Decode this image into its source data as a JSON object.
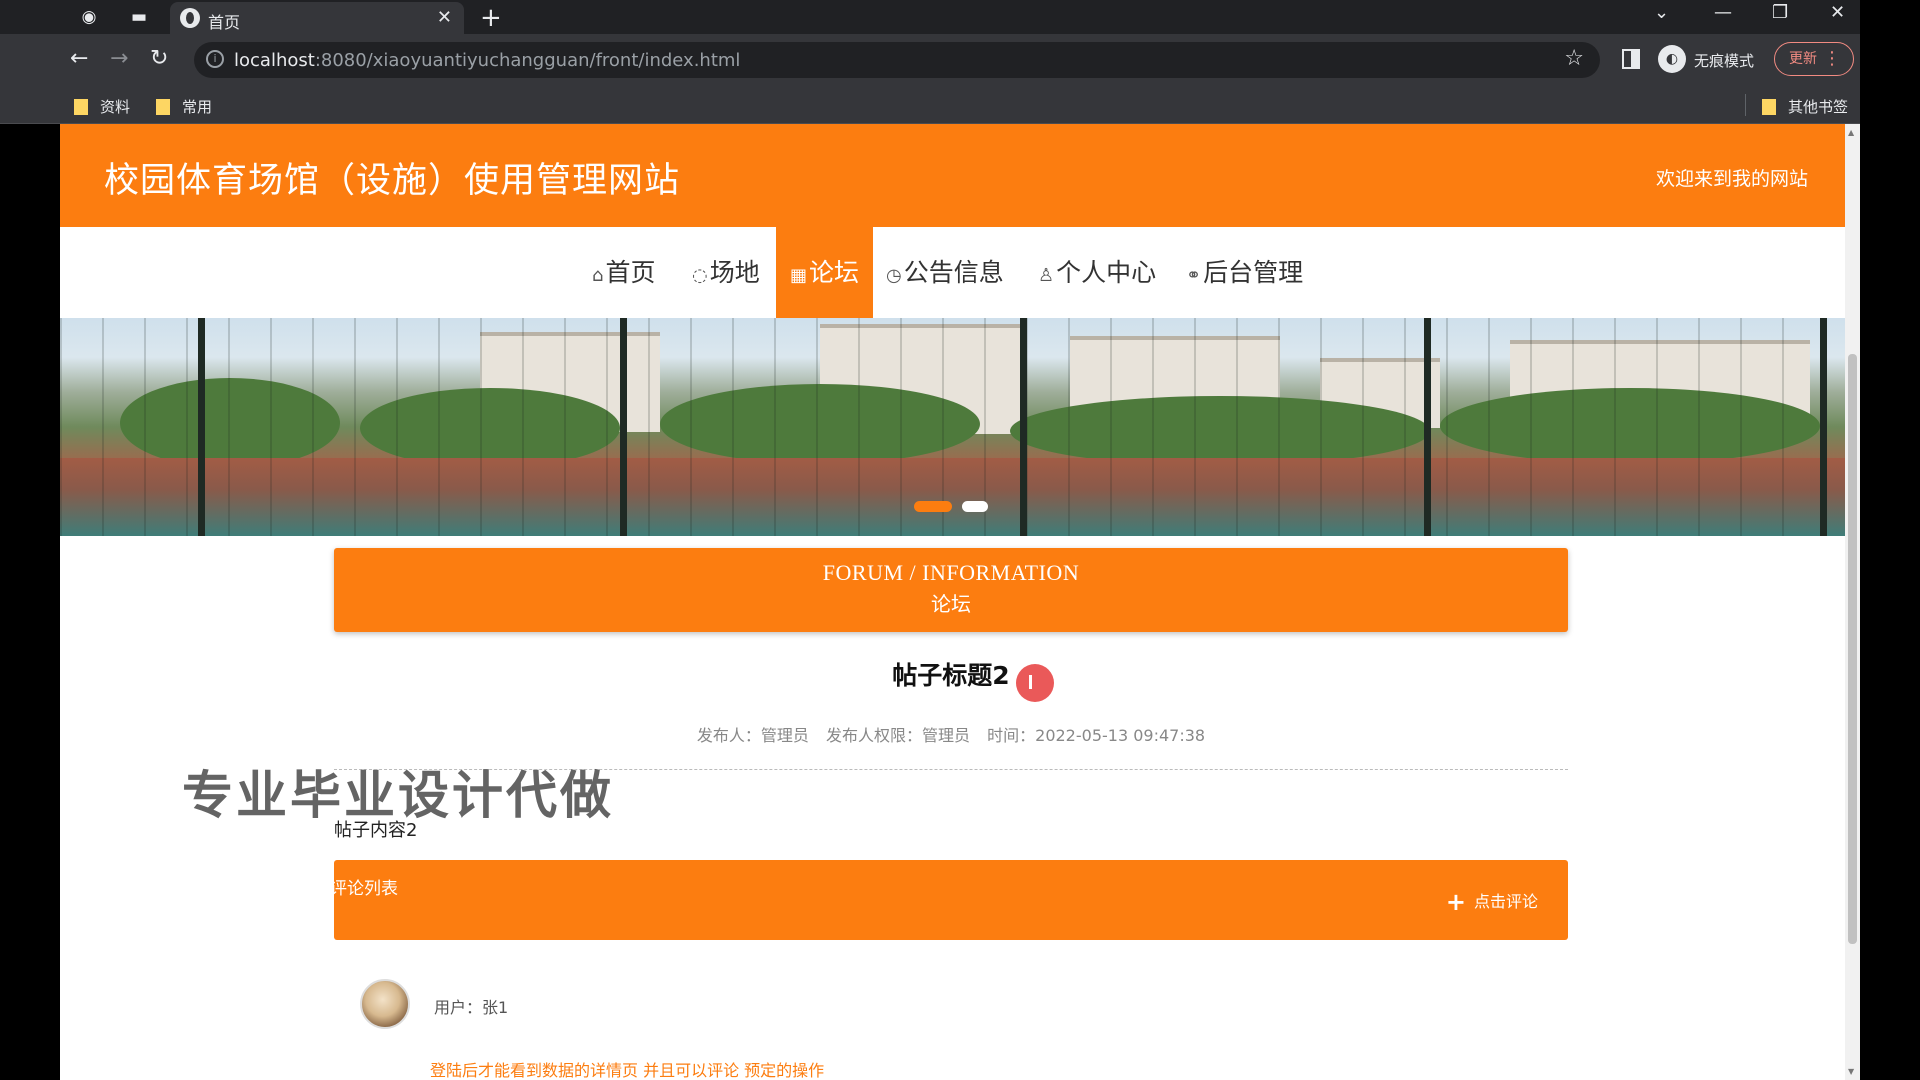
{
  "browser": {
    "tab_title": "首页",
    "url_host": "localhost",
    "url_rest": ":8080/xiaoyuantiyuchangguan/front/index.html",
    "incognito_label": "无痕模式",
    "update_label": "更新",
    "bookmarks": [
      "资料",
      "常用"
    ],
    "other_bookmarks": "其他书签"
  },
  "site": {
    "title": "校园体育场馆（设施）使用管理网站",
    "welcome": "欢迎来到我的网站",
    "nav": [
      {
        "label": "首页",
        "icon": "home-icon"
      },
      {
        "label": "场地",
        "icon": "location-icon"
      },
      {
        "label": "论坛",
        "icon": "forum-icon",
        "active": true
      },
      {
        "label": "公告信息",
        "icon": "notice-icon"
      },
      {
        "label": "个人中心",
        "icon": "user-icon"
      },
      {
        "label": "后台管理",
        "icon": "link-icon"
      }
    ],
    "accent_color": "#fc7d10"
  },
  "section": {
    "en": "FORUM / INFORMATION",
    "cn": "论坛"
  },
  "post": {
    "title": "帖子标题2",
    "meta": {
      "author": "发布人：管理员",
      "role": "发布人权限：管理员",
      "time": "时间：2022-05-13 09:47:38"
    },
    "content": "帖子内容2"
  },
  "comments": {
    "bar_label": "评论列表",
    "add_label": "点击评论",
    "user": "用户：张1",
    "login_hint": "登陆后才能看到数据的详情页 并且可以评论 预定的操作"
  },
  "watermark": "专业毕业设计代做"
}
